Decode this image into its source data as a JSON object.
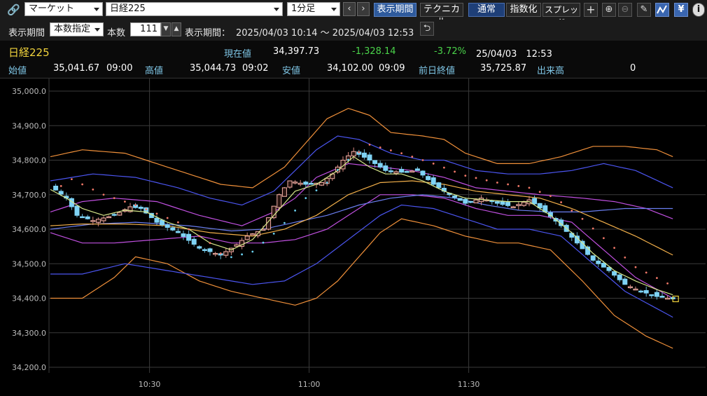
{
  "toolbar": {
    "market_select": "マーケット",
    "symbol_select": "日経225",
    "interval_select": "1分足",
    "prev": "‹",
    "next": "›",
    "btn_period": "表示期間",
    "btn_technical": "テクニカル",
    "btn_normal": "通常",
    "btn_index": "指数化",
    "btn_spread": "スプレッド",
    "icons": [
      "link-icon",
      "crosshair-icon",
      "zoom-in-icon",
      "zoom-out-icon",
      "pencil-icon",
      "chart-pattern-icon",
      "yen-icon",
      "info-icon"
    ]
  },
  "settings": {
    "period_label": "表示期間",
    "mode_select": "本数指定",
    "count_label": "本数",
    "count_value": "111",
    "range_label": "表示期間：",
    "range_value": "2025/04/03 10:14 ～ 2025/04/03 12:53"
  },
  "quote": {
    "name": "日経225",
    "current_label": "現在値",
    "current_value": "34,397.73",
    "change": "-1,328.14",
    "change_pct": "-3.72%",
    "datetime": "25/04/03　12:53",
    "open_label": "始値",
    "open_value": "35,041.67",
    "open_time": "09:00",
    "high_label": "高値",
    "high_value": "35,044.73",
    "high_time": "09:02",
    "low_label": "安値",
    "low_value": "34,102.00",
    "low_time": "09:09",
    "prev_label": "前日終値",
    "prev_value": "35,725.87",
    "volume_label": "出来高",
    "volume_value": "0"
  },
  "chart_data": {
    "type": "candlestick",
    "ylim": [
      34200,
      35000
    ],
    "y_ticks": [
      35000,
      34900,
      34800,
      34700,
      34600,
      34500,
      34400,
      34300,
      34200
    ],
    "y_tick_labels": [
      "35,000.0",
      "34,900.0",
      "34,800.0",
      "34,700.0",
      "34,600.0",
      "34,500.0",
      "34,400.0",
      "34,300.0",
      "34,200.0"
    ],
    "x_ticks": [
      {
        "label": "10:30",
        "index": 16
      },
      {
        "label": "11:00",
        "index": 46
      },
      {
        "label": "11:30",
        "index": 76
      }
    ],
    "candle_count": 111,
    "colors": {
      "up": "#f7b2a8",
      "down": "#7fd3f5",
      "bb_outer": "#f0903a",
      "bb_mid": "#4b55f0",
      "bb_inner": "#c050e0",
      "ma_long": "#f3b04a",
      "ma_short": "#d8e88a",
      "ma_mid": "#6a7ef0",
      "sar_up": "#f07868",
      "sar_down": "#6ad0f0"
    },
    "close_anchors": [
      [
        0,
        34725
      ],
      [
        3,
        34690
      ],
      [
        5,
        34640
      ],
      [
        8,
        34625
      ],
      [
        12,
        34640
      ],
      [
        15,
        34665
      ],
      [
        17,
        34660
      ],
      [
        20,
        34620
      ],
      [
        24,
        34590
      ],
      [
        28,
        34545
      ],
      [
        32,
        34525
      ],
      [
        35,
        34555
      ],
      [
        37,
        34580
      ],
      [
        40,
        34600
      ],
      [
        43,
        34700
      ],
      [
        45,
        34740
      ],
      [
        48,
        34730
      ],
      [
        51,
        34735
      ],
      [
        53,
        34760
      ],
      [
        55,
        34800
      ],
      [
        57,
        34825
      ],
      [
        60,
        34800
      ],
      [
        63,
        34770
      ],
      [
        66,
        34765
      ],
      [
        69,
        34770
      ],
      [
        72,
        34730
      ],
      [
        75,
        34700
      ],
      [
        78,
        34675
      ],
      [
        81,
        34690
      ],
      [
        84,
        34675
      ],
      [
        87,
        34665
      ],
      [
        90,
        34685
      ],
      [
        93,
        34650
      ],
      [
        96,
        34610
      ],
      [
        99,
        34560
      ],
      [
        102,
        34510
      ],
      [
        105,
        34480
      ],
      [
        108,
        34440
      ],
      [
        111,
        34420
      ],
      [
        114,
        34405
      ],
      [
        117,
        34398
      ]
    ],
    "sar_anchors": [
      [
        0,
        34705
      ],
      [
        4,
        34745
      ],
      [
        10,
        34700
      ],
      [
        16,
        34670
      ],
      [
        24,
        34620
      ],
      [
        30,
        34560
      ],
      [
        33,
        34515
      ],
      [
        38,
        34535
      ],
      [
        43,
        34600
      ],
      [
        48,
        34690
      ],
      [
        52,
        34735
      ],
      [
        55,
        34790
      ],
      [
        60,
        34845
      ],
      [
        66,
        34820
      ],
      [
        72,
        34790
      ],
      [
        78,
        34755
      ],
      [
        84,
        34735
      ],
      [
        90,
        34720
      ],
      [
        95,
        34690
      ],
      [
        100,
        34630
      ],
      [
        105,
        34560
      ],
      [
        110,
        34490
      ],
      [
        117,
        34435
      ]
    ],
    "bb_upper2": [
      [
        0,
        34810
      ],
      [
        6,
        34830
      ],
      [
        14,
        34820
      ],
      [
        20,
        34790
      ],
      [
        26,
        34760
      ],
      [
        32,
        34730
      ],
      [
        38,
        34720
      ],
      [
        44,
        34780
      ],
      [
        48,
        34850
      ],
      [
        52,
        34920
      ],
      [
        56,
        34950
      ],
      [
        60,
        34930
      ],
      [
        64,
        34880
      ],
      [
        70,
        34870
      ],
      [
        74,
        34860
      ],
      [
        78,
        34820
      ],
      [
        84,
        34790
      ],
      [
        90,
        34790
      ],
      [
        96,
        34810
      ],
      [
        102,
        34840
      ],
      [
        108,
        34840
      ],
      [
        114,
        34830
      ],
      [
        117,
        34810
      ]
    ],
    "bb_upper1": [
      [
        0,
        34740
      ],
      [
        8,
        34760
      ],
      [
        16,
        34750
      ],
      [
        24,
        34720
      ],
      [
        30,
        34690
      ],
      [
        36,
        34670
      ],
      [
        42,
        34710
      ],
      [
        46,
        34770
      ],
      [
        50,
        34830
      ],
      [
        54,
        34870
      ],
      [
        58,
        34860
      ],
      [
        64,
        34820
      ],
      [
        70,
        34800
      ],
      [
        74,
        34800
      ],
      [
        80,
        34770
      ],
      [
        86,
        34760
      ],
      [
        92,
        34760
      ],
      [
        98,
        34770
      ],
      [
        104,
        34790
      ],
      [
        110,
        34770
      ],
      [
        117,
        34720
      ]
    ],
    "bb_inner_up": [
      [
        0,
        34650
      ],
      [
        6,
        34680
      ],
      [
        12,
        34690
      ],
      [
        20,
        34680
      ],
      [
        28,
        34640
      ],
      [
        36,
        34610
      ],
      [
        42,
        34650
      ],
      [
        46,
        34690
      ],
      [
        50,
        34750
      ],
      [
        56,
        34790
      ],
      [
        62,
        34780
      ],
      [
        68,
        34770
      ],
      [
        74,
        34750
      ],
      [
        80,
        34720
      ],
      [
        86,
        34710
      ],
      [
        92,
        34700
      ],
      [
        100,
        34690
      ],
      [
        106,
        34680
      ],
      [
        112,
        34660
      ],
      [
        117,
        34630
      ]
    ],
    "bb_mid": [
      [
        0,
        34600
      ],
      [
        8,
        34615
      ],
      [
        16,
        34620
      ],
      [
        26,
        34610
      ],
      [
        34,
        34595
      ],
      [
        40,
        34600
      ],
      [
        46,
        34620
      ],
      [
        52,
        34640
      ],
      [
        58,
        34670
      ],
      [
        64,
        34690
      ],
      [
        70,
        34700
      ],
      [
        76,
        34690
      ],
      [
        82,
        34670
      ],
      [
        88,
        34655
      ],
      [
        94,
        34650
      ],
      [
        100,
        34650
      ],
      [
        108,
        34660
      ],
      [
        117,
        34660
      ]
    ],
    "bb_inner_low": [
      [
        0,
        34590
      ],
      [
        6,
        34560
      ],
      [
        12,
        34560
      ],
      [
        20,
        34570
      ],
      [
        28,
        34580
      ],
      [
        34,
        34560
      ],
      [
        40,
        34560
      ],
      [
        46,
        34570
      ],
      [
        52,
        34600
      ],
      [
        58,
        34660
      ],
      [
        62,
        34700
      ],
      [
        68,
        34700
      ],
      [
        74,
        34690
      ],
      [
        80,
        34660
      ],
      [
        86,
        34640
      ],
      [
        92,
        34640
      ],
      [
        98,
        34620
      ],
      [
        104,
        34540
      ],
      [
        110,
        34460
      ],
      [
        117,
        34400
      ]
    ],
    "bb_lower1": [
      [
        0,
        34470
      ],
      [
        6,
        34470
      ],
      [
        14,
        34500
      ],
      [
        22,
        34480
      ],
      [
        30,
        34460
      ],
      [
        38,
        34440
      ],
      [
        44,
        34450
      ],
      [
        50,
        34500
      ],
      [
        56,
        34570
      ],
      [
        62,
        34640
      ],
      [
        66,
        34670
      ],
      [
        72,
        34660
      ],
      [
        78,
        34630
      ],
      [
        84,
        34600
      ],
      [
        90,
        34600
      ],
      [
        96,
        34580
      ],
      [
        102,
        34500
      ],
      [
        108,
        34420
      ],
      [
        117,
        34345
      ]
    ],
    "bb_lower2": [
      [
        0,
        34400
      ],
      [
        6,
        34400
      ],
      [
        12,
        34460
      ],
      [
        16,
        34520
      ],
      [
        22,
        34500
      ],
      [
        28,
        34450
      ],
      [
        34,
        34420
      ],
      [
        40,
        34400
      ],
      [
        46,
        34380
      ],
      [
        50,
        34400
      ],
      [
        54,
        34450
      ],
      [
        58,
        34520
      ],
      [
        62,
        34590
      ],
      [
        66,
        34630
      ],
      [
        72,
        34610
      ],
      [
        78,
        34580
      ],
      [
        84,
        34560
      ],
      [
        88,
        34560
      ],
      [
        94,
        34540
      ],
      [
        100,
        34450
      ],
      [
        106,
        34350
      ],
      [
        112,
        34290
      ],
      [
        117,
        34255
      ]
    ],
    "ma_long": [
      [
        0,
        34610
      ],
      [
        6,
        34615
      ],
      [
        14,
        34615
      ],
      [
        22,
        34610
      ],
      [
        30,
        34590
      ],
      [
        38,
        34580
      ],
      [
        44,
        34600
      ],
      [
        50,
        34640
      ],
      [
        56,
        34700
      ],
      [
        62,
        34735
      ],
      [
        68,
        34740
      ],
      [
        74,
        34730
      ],
      [
        80,
        34710
      ],
      [
        86,
        34700
      ],
      [
        92,
        34690
      ],
      [
        98,
        34660
      ],
      [
        104,
        34620
      ],
      [
        110,
        34580
      ],
      [
        117,
        34525
      ]
    ],
    "ma_short": [
      [
        0,
        34715
      ],
      [
        3,
        34690
      ],
      [
        6,
        34660
      ],
      [
        10,
        34640
      ],
      [
        14,
        34655
      ],
      [
        18,
        34650
      ],
      [
        22,
        34620
      ],
      [
        26,
        34600
      ],
      [
        30,
        34560
      ],
      [
        34,
        34540
      ],
      [
        38,
        34570
      ],
      [
        42,
        34640
      ],
      [
        46,
        34710
      ],
      [
        50,
        34730
      ],
      [
        54,
        34770
      ],
      [
        57,
        34810
      ],
      [
        60,
        34780
      ],
      [
        63,
        34760
      ],
      [
        66,
        34760
      ],
      [
        70,
        34740
      ],
      [
        74,
        34710
      ],
      [
        78,
        34690
      ],
      [
        82,
        34685
      ],
      [
        86,
        34680
      ],
      [
        90,
        34680
      ],
      [
        94,
        34640
      ],
      [
        98,
        34590
      ],
      [
        102,
        34530
      ],
      [
        106,
        34480
      ],
      [
        110,
        34450
      ],
      [
        114,
        34425
      ],
      [
        117,
        34410
      ]
    ]
  }
}
